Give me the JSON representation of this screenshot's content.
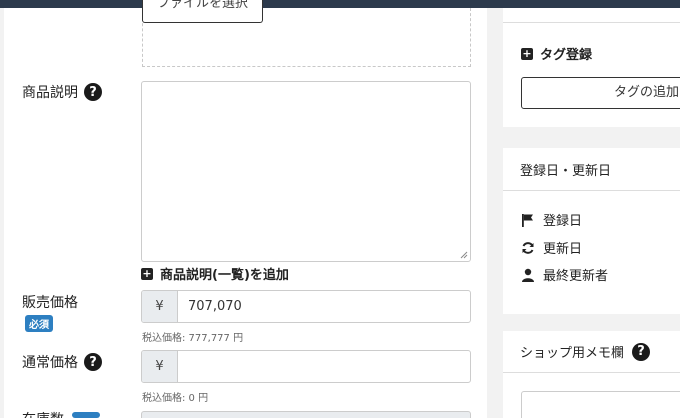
{
  "file_button_label": "ファイルを選択",
  "description": {
    "label": "商品説明",
    "add_list_label": "商品説明(一覧)を追加"
  },
  "sale_price": {
    "label": "販売価格",
    "required_badge": "必須",
    "currency": "¥",
    "value": "707,070",
    "tax_hint": "税込価格: 777,777 円"
  },
  "regular_price": {
    "label": "通常価格",
    "currency": "¥",
    "value": "",
    "tax_hint": "税込価格: 0 円"
  },
  "stock_label": "在庫数",
  "sidebar": {
    "tag": {
      "title": "タグ登録",
      "button_label": "タグの追加"
    },
    "dates": {
      "header": "登録日・更新日",
      "registered_label": "登録日",
      "updated_label": "更新日",
      "last_editor_label": "最終更新者"
    },
    "memo": {
      "header": "ショップ用メモ欄"
    }
  },
  "colors": {
    "topbar": "#2c3a4c",
    "badge": "#2d7fc1",
    "background": "#f2f2f2"
  }
}
